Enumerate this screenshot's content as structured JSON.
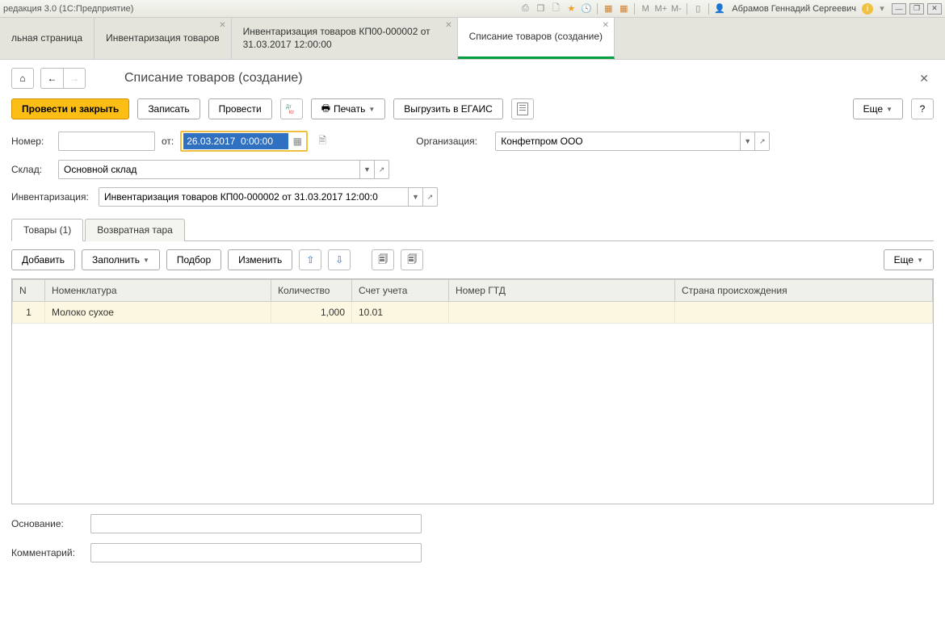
{
  "titlebar": {
    "title": "редакция 3.0  (1С:Предприятие)",
    "user": "Абрамов Геннадий Сергеевич",
    "m_labels": [
      "M",
      "M+",
      "M-"
    ]
  },
  "tabs": [
    {
      "label": "льная страница",
      "closable": false
    },
    {
      "label": "Инвентаризация товаров",
      "closable": true
    },
    {
      "label": "Инвентаризация товаров КП00-000002 от 31.03.2017 12:00:00",
      "closable": true
    },
    {
      "label": "Списание товаров (создание)",
      "closable": true,
      "active": true
    }
  ],
  "page": {
    "title": "Списание товаров (создание)"
  },
  "toolbar": {
    "post_close": "Провести и закрыть",
    "write": "Записать",
    "post": "Провести",
    "print": "Печать",
    "egais": "Выгрузить в ЕГАИС",
    "more": "Еще",
    "help": "?"
  },
  "form": {
    "number_label": "Номер:",
    "number_value": "",
    "date_label": "от:",
    "date_value": "26.03.2017  0:00:00",
    "org_label": "Организация:",
    "org_value": "Конфетпром ООО",
    "warehouse_label": "Склад:",
    "warehouse_value": "Основной склад",
    "inventory_label": "Инвентаризация:",
    "inventory_value": "Инвентаризация товаров КП00-000002 от 31.03.2017 12:00:0",
    "basis_label": "Основание:",
    "basis_value": "",
    "comment_label": "Комментарий:",
    "comment_value": ""
  },
  "subtabs": {
    "goods": "Товары (1)",
    "containers": "Возвратная тара"
  },
  "subtoolbar": {
    "add": "Добавить",
    "fill": "Заполнить",
    "select": "Подбор",
    "edit": "Изменить",
    "more": "Еще"
  },
  "grid": {
    "headers": {
      "n": "N",
      "item": "Номенклатура",
      "qty": "Количество",
      "account": "Счет учета",
      "gtd": "Номер ГТД",
      "country": "Страна происхождения"
    },
    "rows": [
      {
        "n": "1",
        "item": "Молоко сухое",
        "qty": "1,000",
        "account": "10.01",
        "gtd": "",
        "country": ""
      }
    ]
  }
}
